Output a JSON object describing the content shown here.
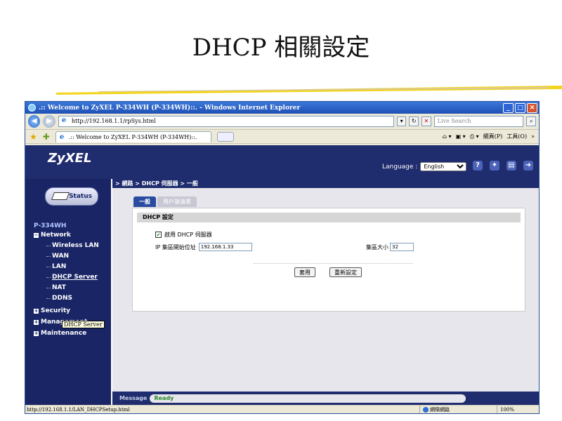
{
  "slide": {
    "title": "DHCP 相關設定"
  },
  "window": {
    "title": ".:: Welcome to ZyXEL P-334WH (P-334WH)::. - Windows Internet Explorer",
    "address": "http://192.168.1.1/rpSys.html",
    "search_placeholder": "Live Search",
    "tab_label": ".:: Welcome to ZyXEL P-334WH (P-334WH)::.",
    "cmd_page": "網頁(P)",
    "cmd_tools": "工具(O)"
  },
  "router": {
    "logo": "ZyXEL",
    "language_label": "Language :",
    "language_value": "English",
    "breadcrumb": "> 網路 > DHCP 伺服器 > 一般",
    "status_button": "Status",
    "tree": {
      "root": "P-334WH",
      "network": "Network",
      "children": [
        "Wireless LAN",
        "WAN",
        "LAN",
        "DHCP Server",
        "NAT",
        "DDNS"
      ],
      "security": "Security",
      "management": "Management",
      "maintenance": "Maintenance"
    },
    "tooltip": "DHCP Server",
    "tabs": {
      "general": "一般",
      "client_list": "用戶端清單"
    },
    "panel_title": "DHCP 設定",
    "enable_label": "啟用 DHCP 伺服器",
    "start_ip_label": "IP 集區開始位址",
    "start_ip_value": "192.168.1.33",
    "pool_size_label": "集區大小",
    "pool_size_value": "32",
    "apply_button": "套用",
    "reset_button": "重新設定",
    "message_label": "Message",
    "message_value": "Ready"
  },
  "statusbar": {
    "url": "http://192.168.1.1/LAN_DHCPSetup.html",
    "zone": "網際網路",
    "zoom": "100%"
  }
}
